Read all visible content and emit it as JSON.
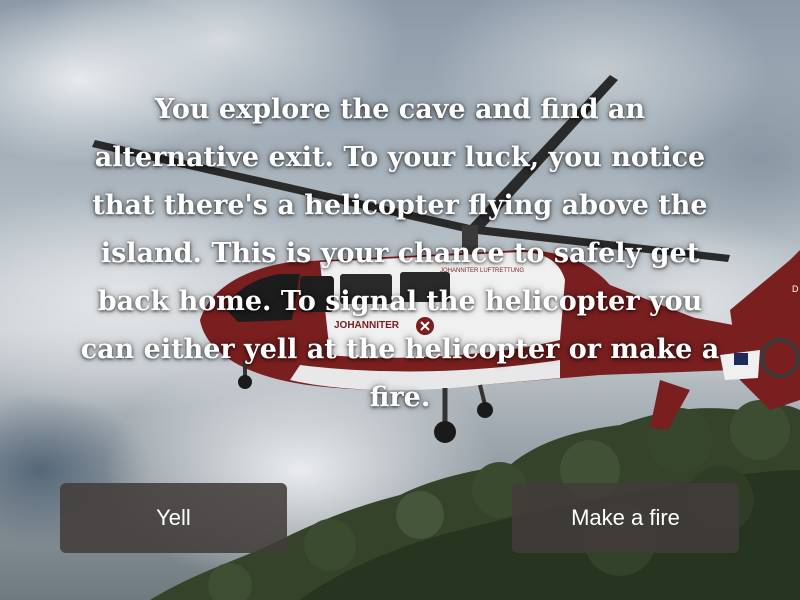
{
  "story": {
    "text": "You explore the cave and find an alternative exit. To your luck, you notice that there's a helicopter flying above the island. This is your chance to safely get back home. To signal the helicopter you can either yell at the helicopter or make a fire."
  },
  "choices": [
    {
      "label": "Yell"
    },
    {
      "label": "Make a fire"
    }
  ],
  "scene": {
    "helicopter_text": "JOHANNITER",
    "helicopter_text_small": "JOHANNITER LUFTRETTUNG",
    "helicopter_tail_mark": "D",
    "colors": {
      "helicopter_body": "#7a1f1f",
      "helicopter_white": "#f2f2f2",
      "forest": "#2f3d24",
      "button_bg": "#423c3a"
    }
  }
}
